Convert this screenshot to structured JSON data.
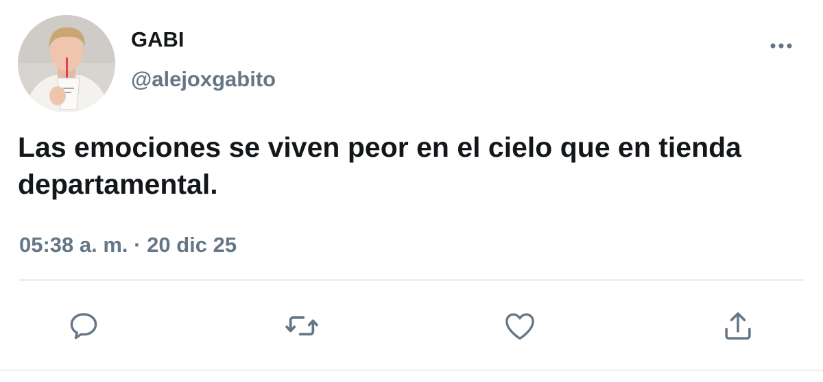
{
  "author": {
    "display_name": "GABI",
    "handle": "@alejoxgabito"
  },
  "tweet": {
    "text": "Las emociones se viven peor en el cielo que en tienda departamental.",
    "time": "05:38 a. m.",
    "separator": "·",
    "date": "20 dic 25"
  },
  "actions": [
    {
      "icon": "reply-icon"
    },
    {
      "icon": "retweet-icon"
    },
    {
      "icon": "like-icon"
    },
    {
      "icon": "share-icon"
    }
  ],
  "colors": {
    "text_primary": "#14171a",
    "text_secondary": "#657786",
    "icon": "#657786",
    "divider": "#e6ecf0"
  }
}
